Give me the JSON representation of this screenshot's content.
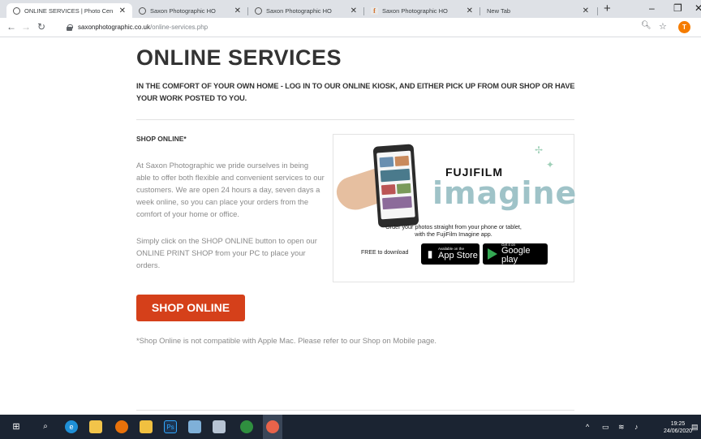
{
  "browser": {
    "tabs": [
      {
        "title": "ONLINE SERVICES | Photo Cen",
        "active": true
      },
      {
        "title": "Saxon Photographic HO"
      },
      {
        "title": "Saxon Photographic HO"
      },
      {
        "title": "Saxon Photographic HO"
      },
      {
        "title": "New Tab"
      }
    ],
    "address": {
      "host": "saxonphotographic.co.uk",
      "path": "/online-services.php"
    },
    "profile_initial": "T"
  },
  "page": {
    "title": "ONLINE SERVICES",
    "subtitle": "IN THE COMFORT OF YOUR OWN HOME - LOG IN TO OUR ONLINE KIOSK, AND EITHER PICK UP FROM OUR SHOP OR HAVE YOUR WORK POSTED TO YOU.",
    "section_heading": "SHOP ONLINE*",
    "para1": "At Saxon Photographic we pride ourselves in being able to offer both flexible and convenient services to our customers. We are open 24 hours a day, seven days a week online, so you can place your orders from the comfort of your home or office.",
    "para2": "Simply click on the SHOP ONLINE button to open our ONLINE PRINT SHOP from your PC to place your orders.",
    "shop_button": "SHOP ONLINE",
    "disclaimer": "*Shop Online is not compatible with Apple Mac. Please refer to our Shop on Mobile page."
  },
  "ad": {
    "brand": "FUJIFILM",
    "product": "imagine",
    "line1": "Order your photos straight from your phone or tablet,",
    "line2": "with the FujiFilm Imagine app.",
    "free_label": "FREE to download",
    "appstore_small": "Available on the",
    "appstore_big": "App Store",
    "gplay_small": "Get it on",
    "gplay_big": "Google play"
  },
  "taskbar": {
    "time": "19:25",
    "date": "24/06/2020"
  },
  "colors": {
    "accent": "#d5401a",
    "taskbar": "#1b2432"
  }
}
